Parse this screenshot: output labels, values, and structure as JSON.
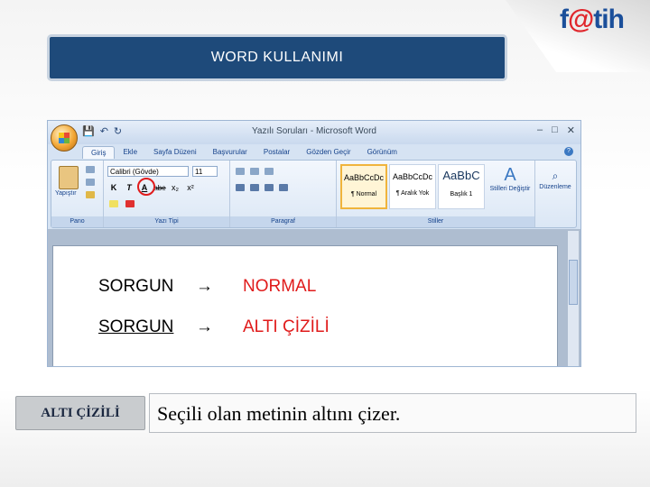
{
  "logo": {
    "text_before": "f",
    "text_at": "@",
    "text_after": "tih"
  },
  "slide_title": "WORD KULLANIMI",
  "word_window": {
    "title": "Yazılı Soruları - Microsoft Word",
    "tabs": [
      "Giriş",
      "Ekle",
      "Sayfa Düzeni",
      "Başvurular",
      "Postalar",
      "Gözden Geçir",
      "Görünüm"
    ],
    "active_tab": "Giriş",
    "groups": {
      "clipboard": "Pano",
      "font": "Yazı Tipi",
      "paragraph": "Paragraf",
      "styles": "Stiller"
    },
    "paste_label": "Yapıştır",
    "font_name": "Calibri (Gövde)",
    "font_size": "11",
    "format_buttons": [
      "K",
      "T",
      "A",
      "abe",
      "x₂",
      "x²"
    ],
    "styles": [
      {
        "sample": "AaBbCcDc",
        "name": "¶ Normal"
      },
      {
        "sample": "AaBbCcDc",
        "name": "¶ Aralık Yok"
      },
      {
        "sample": "AaBbC",
        "name": "Başlık 1"
      }
    ],
    "change_styles": "Stilleri Değiştir",
    "editing": "Düzenleme",
    "window_controls": [
      "–",
      "□",
      "✕"
    ]
  },
  "document": {
    "lines": [
      {
        "source": "SORGUN",
        "arrow": "→",
        "result": "NORMAL"
      },
      {
        "source": "SORGUN",
        "arrow": "→",
        "result": "ALTI ÇİZİLİ"
      }
    ]
  },
  "caption": {
    "label": "ALTI ÇİZİLİ",
    "text": "Seçili olan metinin altını çizer."
  },
  "colors": {
    "title_bg": "#1e4a7a",
    "highlight": "#e01b1b"
  }
}
